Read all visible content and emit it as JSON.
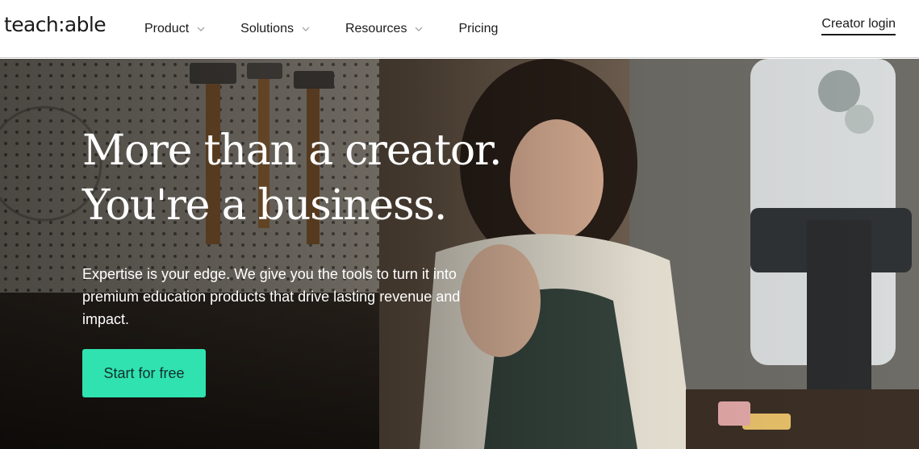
{
  "header": {
    "logo": "teach:able",
    "nav": [
      {
        "label": "Product",
        "has_dropdown": true
      },
      {
        "label": "Solutions",
        "has_dropdown": true
      },
      {
        "label": "Resources",
        "has_dropdown": true
      },
      {
        "label": "Pricing",
        "has_dropdown": false
      }
    ],
    "login_label": "Creator login"
  },
  "hero": {
    "headline_line1": "More than a creator.",
    "headline_line2": "You're a business.",
    "subtext": "Expertise is your edge. We give you the tools to turn it into premium education products that drive lasting revenue and impact.",
    "cta_label": "Start for free",
    "background_image": "woman-in-workshop-filming-video"
  },
  "colors": {
    "accent": "#2fe2b0",
    "header_bg": "#ffffff",
    "text_dark": "#1a1a1a"
  },
  "icons": {
    "dropdown": "chevron-down-icon"
  }
}
